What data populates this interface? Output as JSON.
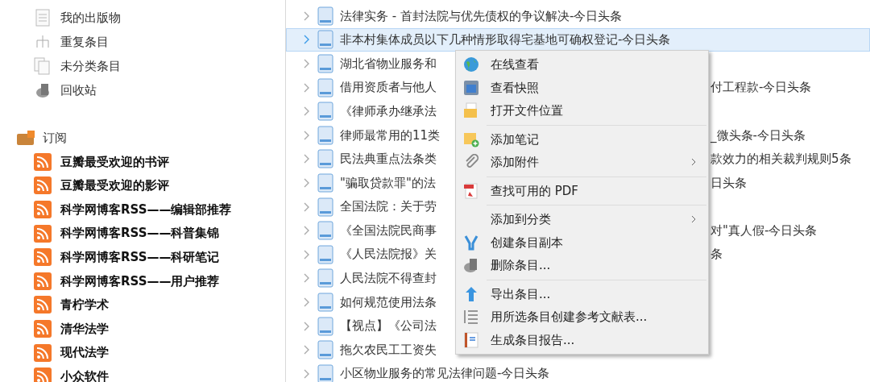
{
  "library": {
    "items": [
      {
        "kind": "publications",
        "label": "我的出版物"
      },
      {
        "kind": "duplicates",
        "label": "重复条目"
      },
      {
        "kind": "unfiled",
        "label": "未分类条目"
      },
      {
        "kind": "trash",
        "label": "回收站"
      }
    ]
  },
  "feeds": {
    "title": "订阅",
    "items": [
      {
        "label": "豆瓣最受欢迎的书评"
      },
      {
        "label": "豆瓣最受欢迎的影评"
      },
      {
        "label": "科学网博客RSS——编辑部推荐"
      },
      {
        "label": "科学网博客RSS——科普集锦"
      },
      {
        "label": "科学网博客RSS——科研笔记"
      },
      {
        "label": "科学网博客RSS——用户推荐"
      },
      {
        "label": "青柠学术"
      },
      {
        "label": "清华法学"
      },
      {
        "label": "现代法学"
      },
      {
        "label": "小众软件"
      }
    ]
  },
  "items": [
    {
      "title": "法律实务 - 首封法院与优先债权的争议解决-今日头条",
      "selected": false
    },
    {
      "title": "非本村集体成员以下几种情形取得宅基地可确权登记-今日头条",
      "selected": true
    },
    {
      "title": "湖北省物业服务和",
      "selected": false
    },
    {
      "title": "借用资质者与他人",
      "tail": "付工程款-今日头条",
      "selected": false
    },
    {
      "title": "《律师承办继承法",
      "selected": false
    },
    {
      "title": "律师最常用的11类",
      "tail": "_微头条-今日头条",
      "selected": false
    },
    {
      "title": "民法典重点法条类",
      "tail": "款效力的相关裁判规则5条",
      "selected": false
    },
    {
      "title": "\"骗取贷款罪\"的法",
      "tail": "日头条",
      "selected": false
    },
    {
      "title": "全国法院：关于劳",
      "selected": false
    },
    {
      "title": "《全国法院民商事",
      "tail": "对\"真人假-今日头条",
      "selected": false
    },
    {
      "title": "《人民法院报》关",
      "tail": "条",
      "selected": false
    },
    {
      "title": "人民法院不得查封",
      "selected": false
    },
    {
      "title": "如何规范使用法条",
      "selected": false
    },
    {
      "title": "【视点】《公司法",
      "selected": false
    },
    {
      "title": "拖欠农民工工资失",
      "selected": false
    },
    {
      "title": "小区物业服务的常见法律问题-今日头条",
      "selected": false
    }
  ],
  "context_menu": {
    "items": [
      {
        "kind": "globe",
        "label": "在线查看"
      },
      {
        "kind": "snapshot",
        "label": "查看快照"
      },
      {
        "kind": "folder",
        "label": "打开文件位置"
      },
      {
        "kind": "separator"
      },
      {
        "kind": "note",
        "label": "添加笔记"
      },
      {
        "kind": "attachment",
        "label": "添加附件",
        "submenu": true
      },
      {
        "kind": "separator"
      },
      {
        "kind": "pdf",
        "label": "查找可用的 PDF"
      },
      {
        "kind": "separator"
      },
      {
        "kind": "none",
        "label": "添加到分类",
        "submenu": true
      },
      {
        "kind": "duplicate",
        "label": "创建条目副本"
      },
      {
        "kind": "trash",
        "label": "删除条目..."
      },
      {
        "kind": "separator"
      },
      {
        "kind": "export",
        "label": "导出条目..."
      },
      {
        "kind": "bibliography",
        "label": "用所选条目创建参考文献表..."
      },
      {
        "kind": "report",
        "label": "生成条目报告..."
      }
    ]
  }
}
